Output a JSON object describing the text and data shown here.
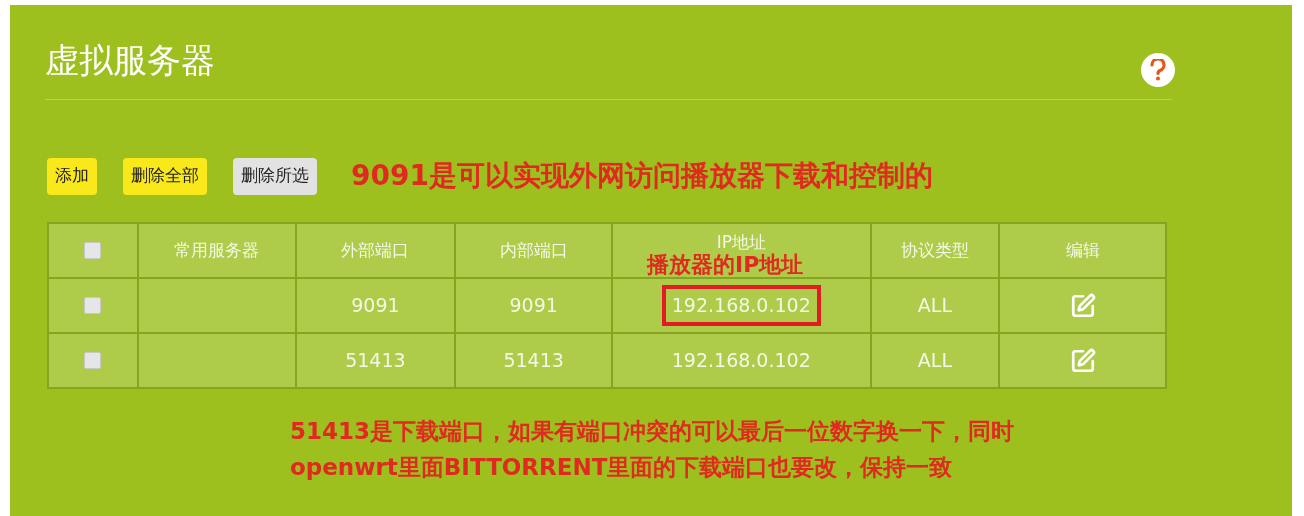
{
  "title": "虚拟服务器",
  "buttons": [
    {
      "label": "添加",
      "kind": "primary"
    },
    {
      "label": "删除全部",
      "kind": "primary"
    },
    {
      "label": "删除所选",
      "kind": "secondary"
    }
  ],
  "annotation_top": "9091是可以实现外网访问播放器下载和控制的",
  "table": {
    "select_all": {
      "checked": false
    },
    "columns": [
      "常用服务器",
      "外部端口",
      "内部端口",
      "IP地址",
      "协议类型",
      "编辑"
    ],
    "ip_annotation": "播放器的IP地址",
    "rows": [
      {
        "checked": false,
        "external": "9091",
        "internal": "9091",
        "ip": "192.168.0.102",
        "ip_boxed": true,
        "protocol": "ALL"
      },
      {
        "checked": false,
        "external": "51413",
        "internal": "51413",
        "ip": "192.168.0.102",
        "ip_boxed": false,
        "protocol": "ALL"
      }
    ]
  },
  "annotation_bottom": [
    "51413是下载端口，如果有端口冲突的可以最后一位数字换一下，同时",
    "openwrt里面BITTORRENT里面的下载端口也要改，保持一致"
  ]
}
